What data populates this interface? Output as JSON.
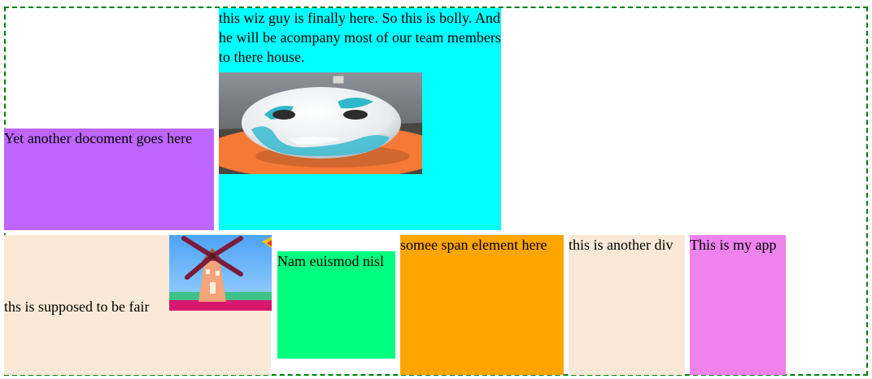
{
  "container": {
    "border_color": "#008000"
  },
  "purple_box": {
    "text": "Yet another docoment goes here",
    "color": "#bf66ff"
  },
  "cyan_box": {
    "text": "this wiz guy is finally here. So this is bolly. And he will be acompany most of our team members to there house.",
    "color": "#00ffff",
    "image": "ufo-character-image"
  },
  "bisque_box": {
    "text": "ths is supposed to be fair",
    "color": "#fae9d6",
    "image": "windmill-image"
  },
  "green_box": {
    "text": "Nam euismod nisl",
    "color": "#00ff7f"
  },
  "orange_span": {
    "text": "somee span element here",
    "color": "#ffa500"
  },
  "another_div": {
    "text": "this is another div",
    "color": "#fae9d6"
  },
  "app_box": {
    "text": "This is my app",
    "color": "#ee82ee"
  }
}
